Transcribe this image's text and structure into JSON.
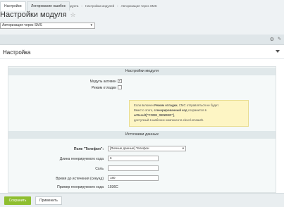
{
  "breadcrumb": [
    "Рабочий стол",
    "Настройки",
    "Настройки продукта",
    "Настройки модулей",
    "Авторизация через SMS"
  ],
  "title": "Настройки модуля",
  "module_select": "Авторизация через SMS",
  "tabs": [
    "Настройки",
    "Логирование ошибок"
  ],
  "panel_title": "Настройка",
  "sections": {
    "module": "Настройки модуля",
    "sources": "Источники данных"
  },
  "options": {
    "active_label": "Модуль активен",
    "active_checked": true,
    "debug_label": "Режим отладки",
    "debug_checked": false
  },
  "note": {
    "line1_a": "Если включен ",
    "line1_bold": "Режим отладки",
    "line1_b": ", СМС отправляться не будет.",
    "line2_a": "Вместо этого, ",
    "line2_bold": "сгенерированный код",
    "line2_b": " сохранится в ",
    "line2_bold2": "arResult[\"CODE_SENDED\"]",
    "line2_c": ",",
    "line3": "доступный в шаблоне компонента clevel.smsauth."
  },
  "fields": {
    "phone_label": "Поле \"Телефон\":",
    "phone_value": "[Личные данные] Телефон",
    "length_label": "Длина генерируемого кода",
    "length_value": "6",
    "salt_label": "Соль",
    "salt_value": "",
    "expire_label": "Время до истечения (секунд)",
    "expire_value": "180",
    "example_label": "Пример генерируемого кода",
    "example_value": "1936C"
  },
  "buttons": {
    "save": "Сохранить",
    "apply": "Применить"
  }
}
